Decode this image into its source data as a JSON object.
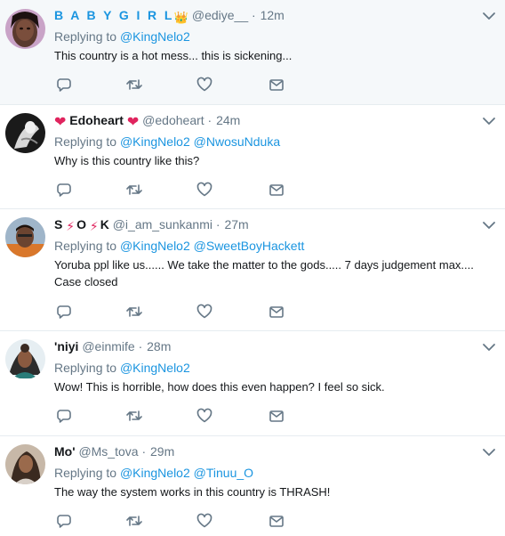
{
  "icons": {
    "reply": "reply-icon",
    "retweet": "retweet-icon",
    "like": "heart-icon",
    "dm": "envelope-icon",
    "more": "chevron-down-icon"
  },
  "colors": {
    "text_primary": "#14171a",
    "text_secondary": "#657786",
    "link": "#1b95e0",
    "divider": "#e6ecf0",
    "highlight_bg": "#f5f8fa",
    "icon_gray": "#657786"
  },
  "tweets": [
    {
      "name": "B A B Y G I R L",
      "name_suffix_emoji": "👑",
      "handle": "@ediye__",
      "dot": "·",
      "time": "12m",
      "replying_prefix": "Replying to",
      "mentions": [
        "@KingNelo2"
      ],
      "text": "This country is a hot mess... this is sickening..."
    },
    {
      "name_prefix_emoji": "❤",
      "name": "Edoheart",
      "name_suffix_emoji": "❤",
      "handle": "@edoheart",
      "dot": "·",
      "time": "24m",
      "replying_prefix": "Replying to",
      "mentions": [
        "@KingNelo2",
        "@NwosuNduka"
      ],
      "text": "Why is this country like this?"
    },
    {
      "name_part1": "S",
      "name_part2": "O",
      "name_part3": "K",
      "lightning": "⚡",
      "handle": "@i_am_sunkanmi",
      "dot": "·",
      "time": "27m",
      "replying_prefix": "Replying to",
      "mentions": [
        "@KingNelo2",
        "@SweetBoyHackett"
      ],
      "text_line1": "Yoruba ppl like us...... We take the matter to the gods..... 7 days judgement max....",
      "text_line2": "Case closed"
    },
    {
      "name": "'niyi",
      "handle": "@einmife",
      "dot": "·",
      "time": "28m",
      "replying_prefix": "Replying to",
      "mentions": [
        "@KingNelo2"
      ],
      "text": "Wow! This is horrible, how does this even happen? I feel so sick."
    },
    {
      "name": "Mo'",
      "handle": "@Ms_tova",
      "dot": "·",
      "time": "29m",
      "replying_prefix": "Replying to",
      "mentions": [
        "@KingNelo2",
        "@Tinuu_O"
      ],
      "text": "The way the system works in this country is THRASH!"
    }
  ]
}
